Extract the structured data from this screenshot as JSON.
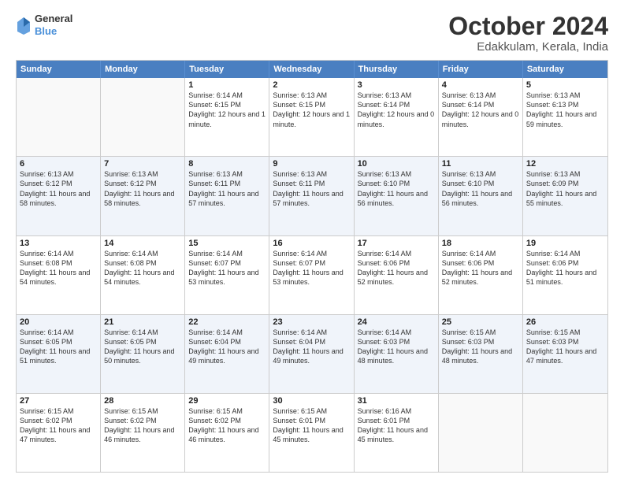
{
  "logo": {
    "line1": "General",
    "line2": "Blue"
  },
  "title": "October 2024",
  "subtitle": "Edakkulam, Kerala, India",
  "header_days": [
    "Sunday",
    "Monday",
    "Tuesday",
    "Wednesday",
    "Thursday",
    "Friday",
    "Saturday"
  ],
  "rows": [
    [
      {
        "day": "",
        "sunrise": "",
        "sunset": "",
        "daylight": "",
        "alt": false,
        "empty": true
      },
      {
        "day": "",
        "sunrise": "",
        "sunset": "",
        "daylight": "",
        "alt": false,
        "empty": true
      },
      {
        "day": "1",
        "sunrise": "Sunrise: 6:14 AM",
        "sunset": "Sunset: 6:15 PM",
        "daylight": "Daylight: 12 hours and 1 minute.",
        "alt": false,
        "empty": false
      },
      {
        "day": "2",
        "sunrise": "Sunrise: 6:13 AM",
        "sunset": "Sunset: 6:15 PM",
        "daylight": "Daylight: 12 hours and 1 minute.",
        "alt": false,
        "empty": false
      },
      {
        "day": "3",
        "sunrise": "Sunrise: 6:13 AM",
        "sunset": "Sunset: 6:14 PM",
        "daylight": "Daylight: 12 hours and 0 minutes.",
        "alt": false,
        "empty": false
      },
      {
        "day": "4",
        "sunrise": "Sunrise: 6:13 AM",
        "sunset": "Sunset: 6:14 PM",
        "daylight": "Daylight: 12 hours and 0 minutes.",
        "alt": false,
        "empty": false
      },
      {
        "day": "5",
        "sunrise": "Sunrise: 6:13 AM",
        "sunset": "Sunset: 6:13 PM",
        "daylight": "Daylight: 11 hours and 59 minutes.",
        "alt": false,
        "empty": false
      }
    ],
    [
      {
        "day": "6",
        "sunrise": "Sunrise: 6:13 AM",
        "sunset": "Sunset: 6:12 PM",
        "daylight": "Daylight: 11 hours and 58 minutes.",
        "alt": true,
        "empty": false
      },
      {
        "day": "7",
        "sunrise": "Sunrise: 6:13 AM",
        "sunset": "Sunset: 6:12 PM",
        "daylight": "Daylight: 11 hours and 58 minutes.",
        "alt": true,
        "empty": false
      },
      {
        "day": "8",
        "sunrise": "Sunrise: 6:13 AM",
        "sunset": "Sunset: 6:11 PM",
        "daylight": "Daylight: 11 hours and 57 minutes.",
        "alt": true,
        "empty": false
      },
      {
        "day": "9",
        "sunrise": "Sunrise: 6:13 AM",
        "sunset": "Sunset: 6:11 PM",
        "daylight": "Daylight: 11 hours and 57 minutes.",
        "alt": true,
        "empty": false
      },
      {
        "day": "10",
        "sunrise": "Sunrise: 6:13 AM",
        "sunset": "Sunset: 6:10 PM",
        "daylight": "Daylight: 11 hours and 56 minutes.",
        "alt": true,
        "empty": false
      },
      {
        "day": "11",
        "sunrise": "Sunrise: 6:13 AM",
        "sunset": "Sunset: 6:10 PM",
        "daylight": "Daylight: 11 hours and 56 minutes.",
        "alt": true,
        "empty": false
      },
      {
        "day": "12",
        "sunrise": "Sunrise: 6:13 AM",
        "sunset": "Sunset: 6:09 PM",
        "daylight": "Daylight: 11 hours and 55 minutes.",
        "alt": true,
        "empty": false
      }
    ],
    [
      {
        "day": "13",
        "sunrise": "Sunrise: 6:14 AM",
        "sunset": "Sunset: 6:08 PM",
        "daylight": "Daylight: 11 hours and 54 minutes.",
        "alt": false,
        "empty": false
      },
      {
        "day": "14",
        "sunrise": "Sunrise: 6:14 AM",
        "sunset": "Sunset: 6:08 PM",
        "daylight": "Daylight: 11 hours and 54 minutes.",
        "alt": false,
        "empty": false
      },
      {
        "day": "15",
        "sunrise": "Sunrise: 6:14 AM",
        "sunset": "Sunset: 6:07 PM",
        "daylight": "Daylight: 11 hours and 53 minutes.",
        "alt": false,
        "empty": false
      },
      {
        "day": "16",
        "sunrise": "Sunrise: 6:14 AM",
        "sunset": "Sunset: 6:07 PM",
        "daylight": "Daylight: 11 hours and 53 minutes.",
        "alt": false,
        "empty": false
      },
      {
        "day": "17",
        "sunrise": "Sunrise: 6:14 AM",
        "sunset": "Sunset: 6:06 PM",
        "daylight": "Daylight: 11 hours and 52 minutes.",
        "alt": false,
        "empty": false
      },
      {
        "day": "18",
        "sunrise": "Sunrise: 6:14 AM",
        "sunset": "Sunset: 6:06 PM",
        "daylight": "Daylight: 11 hours and 52 minutes.",
        "alt": false,
        "empty": false
      },
      {
        "day": "19",
        "sunrise": "Sunrise: 6:14 AM",
        "sunset": "Sunset: 6:06 PM",
        "daylight": "Daylight: 11 hours and 51 minutes.",
        "alt": false,
        "empty": false
      }
    ],
    [
      {
        "day": "20",
        "sunrise": "Sunrise: 6:14 AM",
        "sunset": "Sunset: 6:05 PM",
        "daylight": "Daylight: 11 hours and 51 minutes.",
        "alt": true,
        "empty": false
      },
      {
        "day": "21",
        "sunrise": "Sunrise: 6:14 AM",
        "sunset": "Sunset: 6:05 PM",
        "daylight": "Daylight: 11 hours and 50 minutes.",
        "alt": true,
        "empty": false
      },
      {
        "day": "22",
        "sunrise": "Sunrise: 6:14 AM",
        "sunset": "Sunset: 6:04 PM",
        "daylight": "Daylight: 11 hours and 49 minutes.",
        "alt": true,
        "empty": false
      },
      {
        "day": "23",
        "sunrise": "Sunrise: 6:14 AM",
        "sunset": "Sunset: 6:04 PM",
        "daylight": "Daylight: 11 hours and 49 minutes.",
        "alt": true,
        "empty": false
      },
      {
        "day": "24",
        "sunrise": "Sunrise: 6:14 AM",
        "sunset": "Sunset: 6:03 PM",
        "daylight": "Daylight: 11 hours and 48 minutes.",
        "alt": true,
        "empty": false
      },
      {
        "day": "25",
        "sunrise": "Sunrise: 6:15 AM",
        "sunset": "Sunset: 6:03 PM",
        "daylight": "Daylight: 11 hours and 48 minutes.",
        "alt": true,
        "empty": false
      },
      {
        "day": "26",
        "sunrise": "Sunrise: 6:15 AM",
        "sunset": "Sunset: 6:03 PM",
        "daylight": "Daylight: 11 hours and 47 minutes.",
        "alt": true,
        "empty": false
      }
    ],
    [
      {
        "day": "27",
        "sunrise": "Sunrise: 6:15 AM",
        "sunset": "Sunset: 6:02 PM",
        "daylight": "Daylight: 11 hours and 47 minutes.",
        "alt": false,
        "empty": false
      },
      {
        "day": "28",
        "sunrise": "Sunrise: 6:15 AM",
        "sunset": "Sunset: 6:02 PM",
        "daylight": "Daylight: 11 hours and 46 minutes.",
        "alt": false,
        "empty": false
      },
      {
        "day": "29",
        "sunrise": "Sunrise: 6:15 AM",
        "sunset": "Sunset: 6:02 PM",
        "daylight": "Daylight: 11 hours and 46 minutes.",
        "alt": false,
        "empty": false
      },
      {
        "day": "30",
        "sunrise": "Sunrise: 6:15 AM",
        "sunset": "Sunset: 6:01 PM",
        "daylight": "Daylight: 11 hours and 45 minutes.",
        "alt": false,
        "empty": false
      },
      {
        "day": "31",
        "sunrise": "Sunrise: 6:16 AM",
        "sunset": "Sunset: 6:01 PM",
        "daylight": "Daylight: 11 hours and 45 minutes.",
        "alt": false,
        "empty": false
      },
      {
        "day": "",
        "sunrise": "",
        "sunset": "",
        "daylight": "",
        "alt": false,
        "empty": true
      },
      {
        "day": "",
        "sunrise": "",
        "sunset": "",
        "daylight": "",
        "alt": false,
        "empty": true
      }
    ]
  ]
}
